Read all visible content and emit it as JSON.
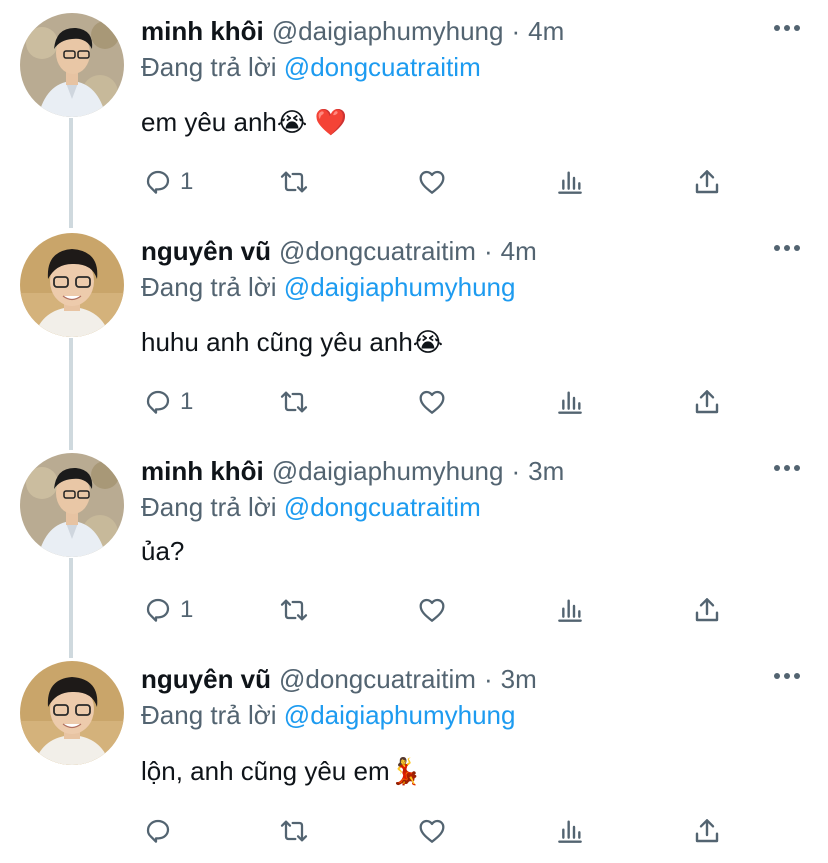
{
  "reply_prefix": "Đang trả lời",
  "tweets": [
    {
      "name": "minh khôi",
      "handle": "@daigiaphumyhung",
      "separator": "·",
      "time": "4m",
      "reply_to": "@dongcuatraitim",
      "text": "em yêu anh😭",
      "text_emoji": "❤️",
      "reply_count": "1",
      "avatar": "minh-khoi-avatar"
    },
    {
      "name": "nguyên vũ",
      "handle": "@dongcuatraitim",
      "separator": "·",
      "time": "4m",
      "reply_to": "@daigiaphumyhung",
      "text": "huhu anh cũng yêu anh😭",
      "text_emoji": "",
      "reply_count": "1",
      "avatar": "nguyen-vu-avatar"
    },
    {
      "name": "minh khôi",
      "handle": "@daigiaphumyhung",
      "separator": "·",
      "time": "3m",
      "reply_to": "@dongcuatraitim",
      "text": "ủa?",
      "text_emoji": "",
      "reply_count": "1",
      "avatar": "minh-khoi-avatar"
    },
    {
      "name": "nguyên vũ",
      "handle": "@dongcuatraitim",
      "separator": "·",
      "time": "3m",
      "reply_to": "@daigiaphumyhung",
      "text": "lộn, anh cũng yêu em💃",
      "text_emoji": "",
      "reply_count": "",
      "avatar": "nguyen-vu-avatar"
    }
  ],
  "icons": {
    "reply": "reply-icon",
    "retweet": "retweet-icon",
    "like": "heart-icon",
    "views": "views-icon",
    "share": "share-icon",
    "more": "more-icon"
  },
  "colors": {
    "text": "#0f1419",
    "secondary": "#536471",
    "link": "#1d9bf0",
    "thread_line": "#cfd9de"
  }
}
